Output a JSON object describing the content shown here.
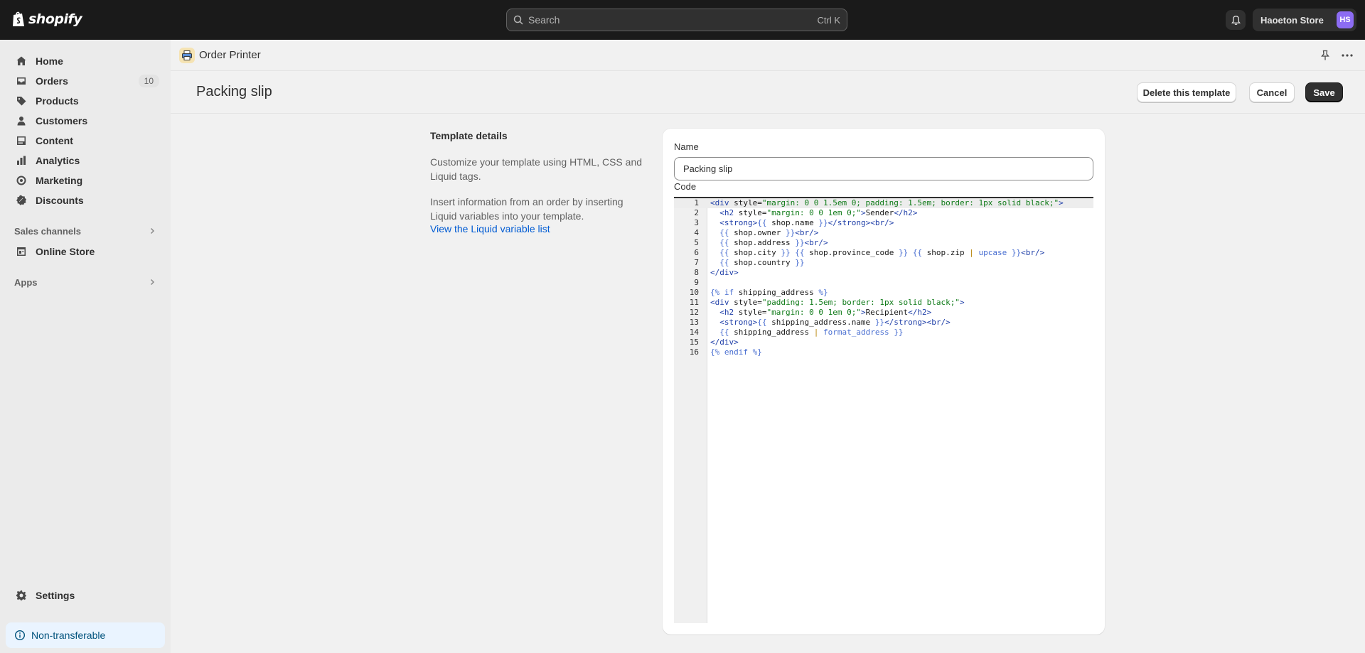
{
  "topbar": {
    "brand": "shopify",
    "search_placeholder": "Search",
    "search_shortcut": "Ctrl K",
    "store_name": "Haoeton Store",
    "avatar_initials": "HS"
  },
  "sidebar": {
    "items": [
      {
        "label": "Home",
        "icon": "home-icon"
      },
      {
        "label": "Orders",
        "icon": "orders-icon",
        "badge": "10"
      },
      {
        "label": "Products",
        "icon": "tag-icon"
      },
      {
        "label": "Customers",
        "icon": "person-icon"
      },
      {
        "label": "Content",
        "icon": "content-icon"
      },
      {
        "label": "Analytics",
        "icon": "bar-chart-icon"
      },
      {
        "label": "Marketing",
        "icon": "target-icon"
      },
      {
        "label": "Discounts",
        "icon": "discount-icon"
      }
    ],
    "sales_channels": "Sales channels",
    "online_store": "Online Store",
    "apps": "Apps",
    "settings": "Settings",
    "non_transferable": "Non-transferable"
  },
  "app": {
    "title": "Order Printer"
  },
  "page": {
    "title": "Packing slip",
    "delete_label": "Delete this template",
    "cancel_label": "Cancel",
    "save_label": "Save"
  },
  "details": {
    "title": "Template details",
    "p1": "Customize your template using HTML, CSS and Liquid tags.",
    "p2": "Insert information from an order by inserting Liquid variables into your template.",
    "link": "View the Liquid variable list"
  },
  "form": {
    "name_label": "Name",
    "name_value": "Packing slip",
    "code_label": "Code",
    "code_lines": [
      "<div style=\"margin: 0 0 1.5em 0; padding: 1.5em; border: 1px solid black;\">",
      "  <h2 style=\"margin: 0 0 1em 0;\">Sender</h2>",
      "  <strong>{{ shop.name }}</strong><br/>",
      "  {{ shop.owner }}<br/>",
      "  {{ shop.address }}<br/>",
      "  {{ shop.city }} {{ shop.province_code }} {{ shop.zip | upcase }}<br/>",
      "  {{ shop.country }}",
      "</div>",
      "",
      "{% if shipping_address %}",
      "<div style=\"padding: 1.5em; border: 1px solid black;\">",
      "  <h2 style=\"margin: 0 0 1em 0;\">Recipient</h2>",
      "  <strong>{{ shipping_address.name }}</strong><br/>",
      "  {{ shipping_address | format_address }}",
      "</div>",
      "{% endif %}"
    ]
  }
}
